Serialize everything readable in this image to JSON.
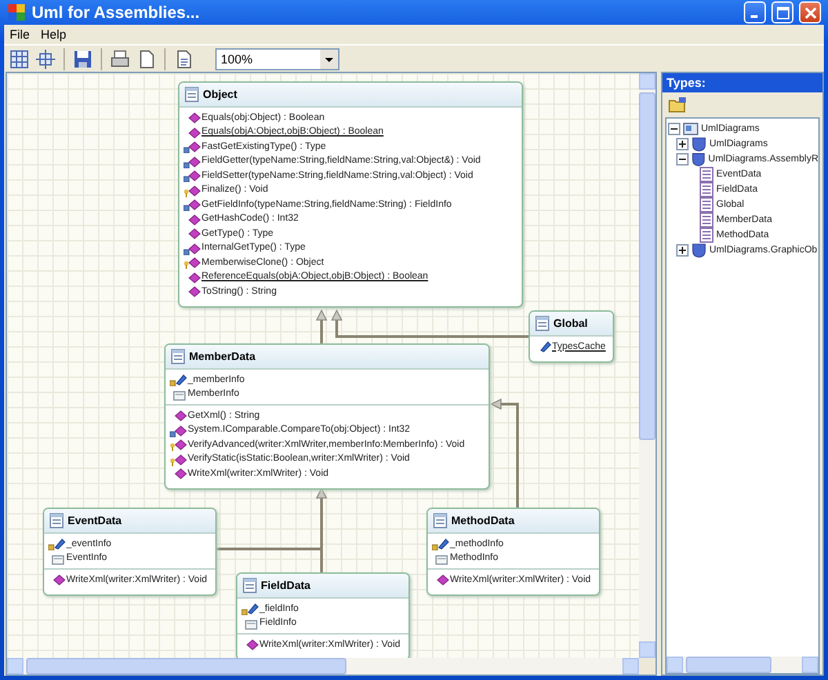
{
  "window": {
    "title": "Uml for Assemblies..."
  },
  "menu": [
    {
      "label": "File"
    },
    {
      "label": "Help"
    }
  ],
  "toolbar": {
    "zoom": "100%"
  },
  "classes": [
    {
      "name": "Object",
      "operations": [
        {
          "text": "Equals(obj:Object) : Boolean",
          "kind": "public",
          "static": false
        },
        {
          "text": "Equals(objA:Object,objB:Object) : Boolean",
          "kind": "public",
          "static": true
        },
        {
          "text": "FastGetExistingType() : Type",
          "kind": "internal",
          "static": false
        },
        {
          "text": "FieldGetter(typeName:String,fieldName:String,val:Object&) : Void",
          "kind": "internal",
          "static": false
        },
        {
          "text": "FieldSetter(typeName:String,fieldName:String,val:Object) : Void",
          "kind": "internal",
          "static": false
        },
        {
          "text": "Finalize() : Void",
          "kind": "protected",
          "static": false
        },
        {
          "text": "GetFieldInfo(typeName:String,fieldName:String) : FieldInfo",
          "kind": "internal",
          "static": false
        },
        {
          "text": "GetHashCode() : Int32",
          "kind": "public",
          "static": false
        },
        {
          "text": "GetType() : Type",
          "kind": "public",
          "static": false
        },
        {
          "text": "InternalGetType() : Type",
          "kind": "internal",
          "static": false
        },
        {
          "text": "MemberwiseClone() : Object",
          "kind": "protected",
          "static": false
        },
        {
          "text": "ReferenceEquals(objA:Object,objB:Object) : Boolean",
          "kind": "public",
          "static": true
        },
        {
          "text": "ToString() : String",
          "kind": "public",
          "static": false
        }
      ]
    },
    {
      "name": "Global",
      "attributes": [
        {
          "text": "TypesCache",
          "kind": "field",
          "private": false,
          "static": true
        }
      ]
    },
    {
      "name": "MemberData",
      "attributes": [
        {
          "text": "_memberInfo",
          "kind": "field",
          "private": true,
          "static": false
        },
        {
          "text": "MemberInfo",
          "kind": "property",
          "private": false,
          "static": false
        }
      ],
      "operations": [
        {
          "text": "GetXml() : String",
          "kind": "public",
          "static": false
        },
        {
          "text": "System.IComparable.CompareTo(obj:Object) : Int32",
          "kind": "internal",
          "static": false
        },
        {
          "text": "VerifyAdvanced(writer:XmlWriter,memberInfo:MemberInfo) : Void",
          "kind": "protected",
          "static": false
        },
        {
          "text": "VerifyStatic(isStatic:Boolean,writer:XmlWriter) : Void",
          "kind": "protected",
          "static": false
        },
        {
          "text": "WriteXml(writer:XmlWriter) : Void",
          "kind": "public",
          "static": false
        }
      ]
    },
    {
      "name": "EventData",
      "attributes": [
        {
          "text": "_eventInfo",
          "kind": "field",
          "private": true,
          "static": false
        },
        {
          "text": "EventInfo",
          "kind": "property",
          "private": false,
          "static": false
        }
      ],
      "operations": [
        {
          "text": "WriteXml(writer:XmlWriter) : Void",
          "kind": "public",
          "static": false
        }
      ]
    },
    {
      "name": "MethodData",
      "attributes": [
        {
          "text": "_methodInfo",
          "kind": "field",
          "private": true,
          "static": false
        },
        {
          "text": "MethodInfo",
          "kind": "property",
          "private": false,
          "static": false
        }
      ],
      "operations": [
        {
          "text": "WriteXml(writer:XmlWriter) : Void",
          "kind": "public",
          "static": false
        }
      ]
    },
    {
      "name": "FieldData",
      "attributes": [
        {
          "text": "_fieldInfo",
          "kind": "field",
          "private": true,
          "static": false
        },
        {
          "text": "FieldInfo",
          "kind": "property",
          "private": false,
          "static": false
        }
      ],
      "operations": [
        {
          "text": "WriteXml(writer:XmlWriter) : Void",
          "kind": "public",
          "static": false
        }
      ]
    }
  ],
  "types_panel": {
    "title": "Types:",
    "tree": [
      {
        "label": "UmlDiagrams",
        "kind": "assembly",
        "expanded": true,
        "children": [
          {
            "label": "UmlDiagrams",
            "kind": "namespace",
            "expanded": false
          },
          {
            "label": "UmlDiagrams.AssemblyR",
            "kind": "namespace",
            "expanded": true,
            "children": [
              {
                "label": "EventData",
                "kind": "class"
              },
              {
                "label": "FieldData",
                "kind": "class"
              },
              {
                "label": "Global",
                "kind": "class"
              },
              {
                "label": "MemberData",
                "kind": "class"
              },
              {
                "label": "MethodData",
                "kind": "class"
              }
            ]
          },
          {
            "label": "UmlDiagrams.GraphicOb",
            "kind": "namespace",
            "expanded": false
          }
        ]
      }
    ]
  }
}
